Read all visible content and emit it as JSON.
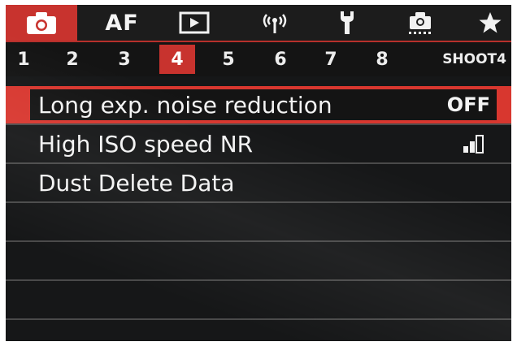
{
  "tabs": [
    {
      "name": "camera-icon",
      "active": true
    },
    {
      "name": "af-tab",
      "label": "AF"
    },
    {
      "name": "playback-icon"
    },
    {
      "name": "wireless-icon"
    },
    {
      "name": "wrench-icon"
    },
    {
      "name": "custom-function-icon"
    },
    {
      "name": "star-icon"
    }
  ],
  "pages": {
    "items": [
      "1",
      "2",
      "3",
      "4",
      "5",
      "6",
      "7",
      "8"
    ],
    "active": "4",
    "section_name": "SHOOT4"
  },
  "menu": {
    "items": [
      {
        "label": "Long exp. noise reduction",
        "value": "OFF",
        "selected": true
      },
      {
        "label": "High ISO speed NR",
        "value_icon": "nr-level-icon"
      },
      {
        "label": "Dust Delete Data"
      }
    ]
  },
  "colors": {
    "accent": "#c8332e",
    "background": "#161718",
    "text": "#f3f3f3",
    "divider": "#4a4a4a"
  }
}
